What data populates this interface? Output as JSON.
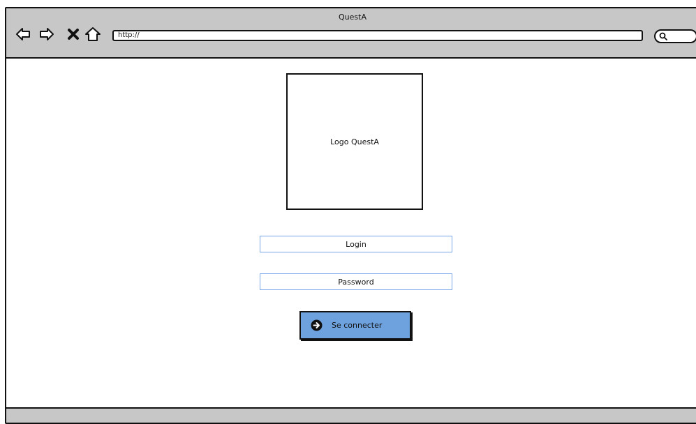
{
  "window": {
    "title": "QuestA"
  },
  "toolbar": {
    "url": "http://",
    "icons": [
      "back-icon",
      "forward-icon",
      "close-icon",
      "home-icon",
      "search-icon"
    ]
  },
  "main": {
    "logo_text": "Logo QuestA",
    "login_placeholder": "Login",
    "password_placeholder": "Password",
    "connect_button": "Se connecter"
  },
  "colors": {
    "toolbar_bg": "#c7c7c7",
    "button_bg": "#6ea2de",
    "field_border": "#7aa7e9"
  }
}
